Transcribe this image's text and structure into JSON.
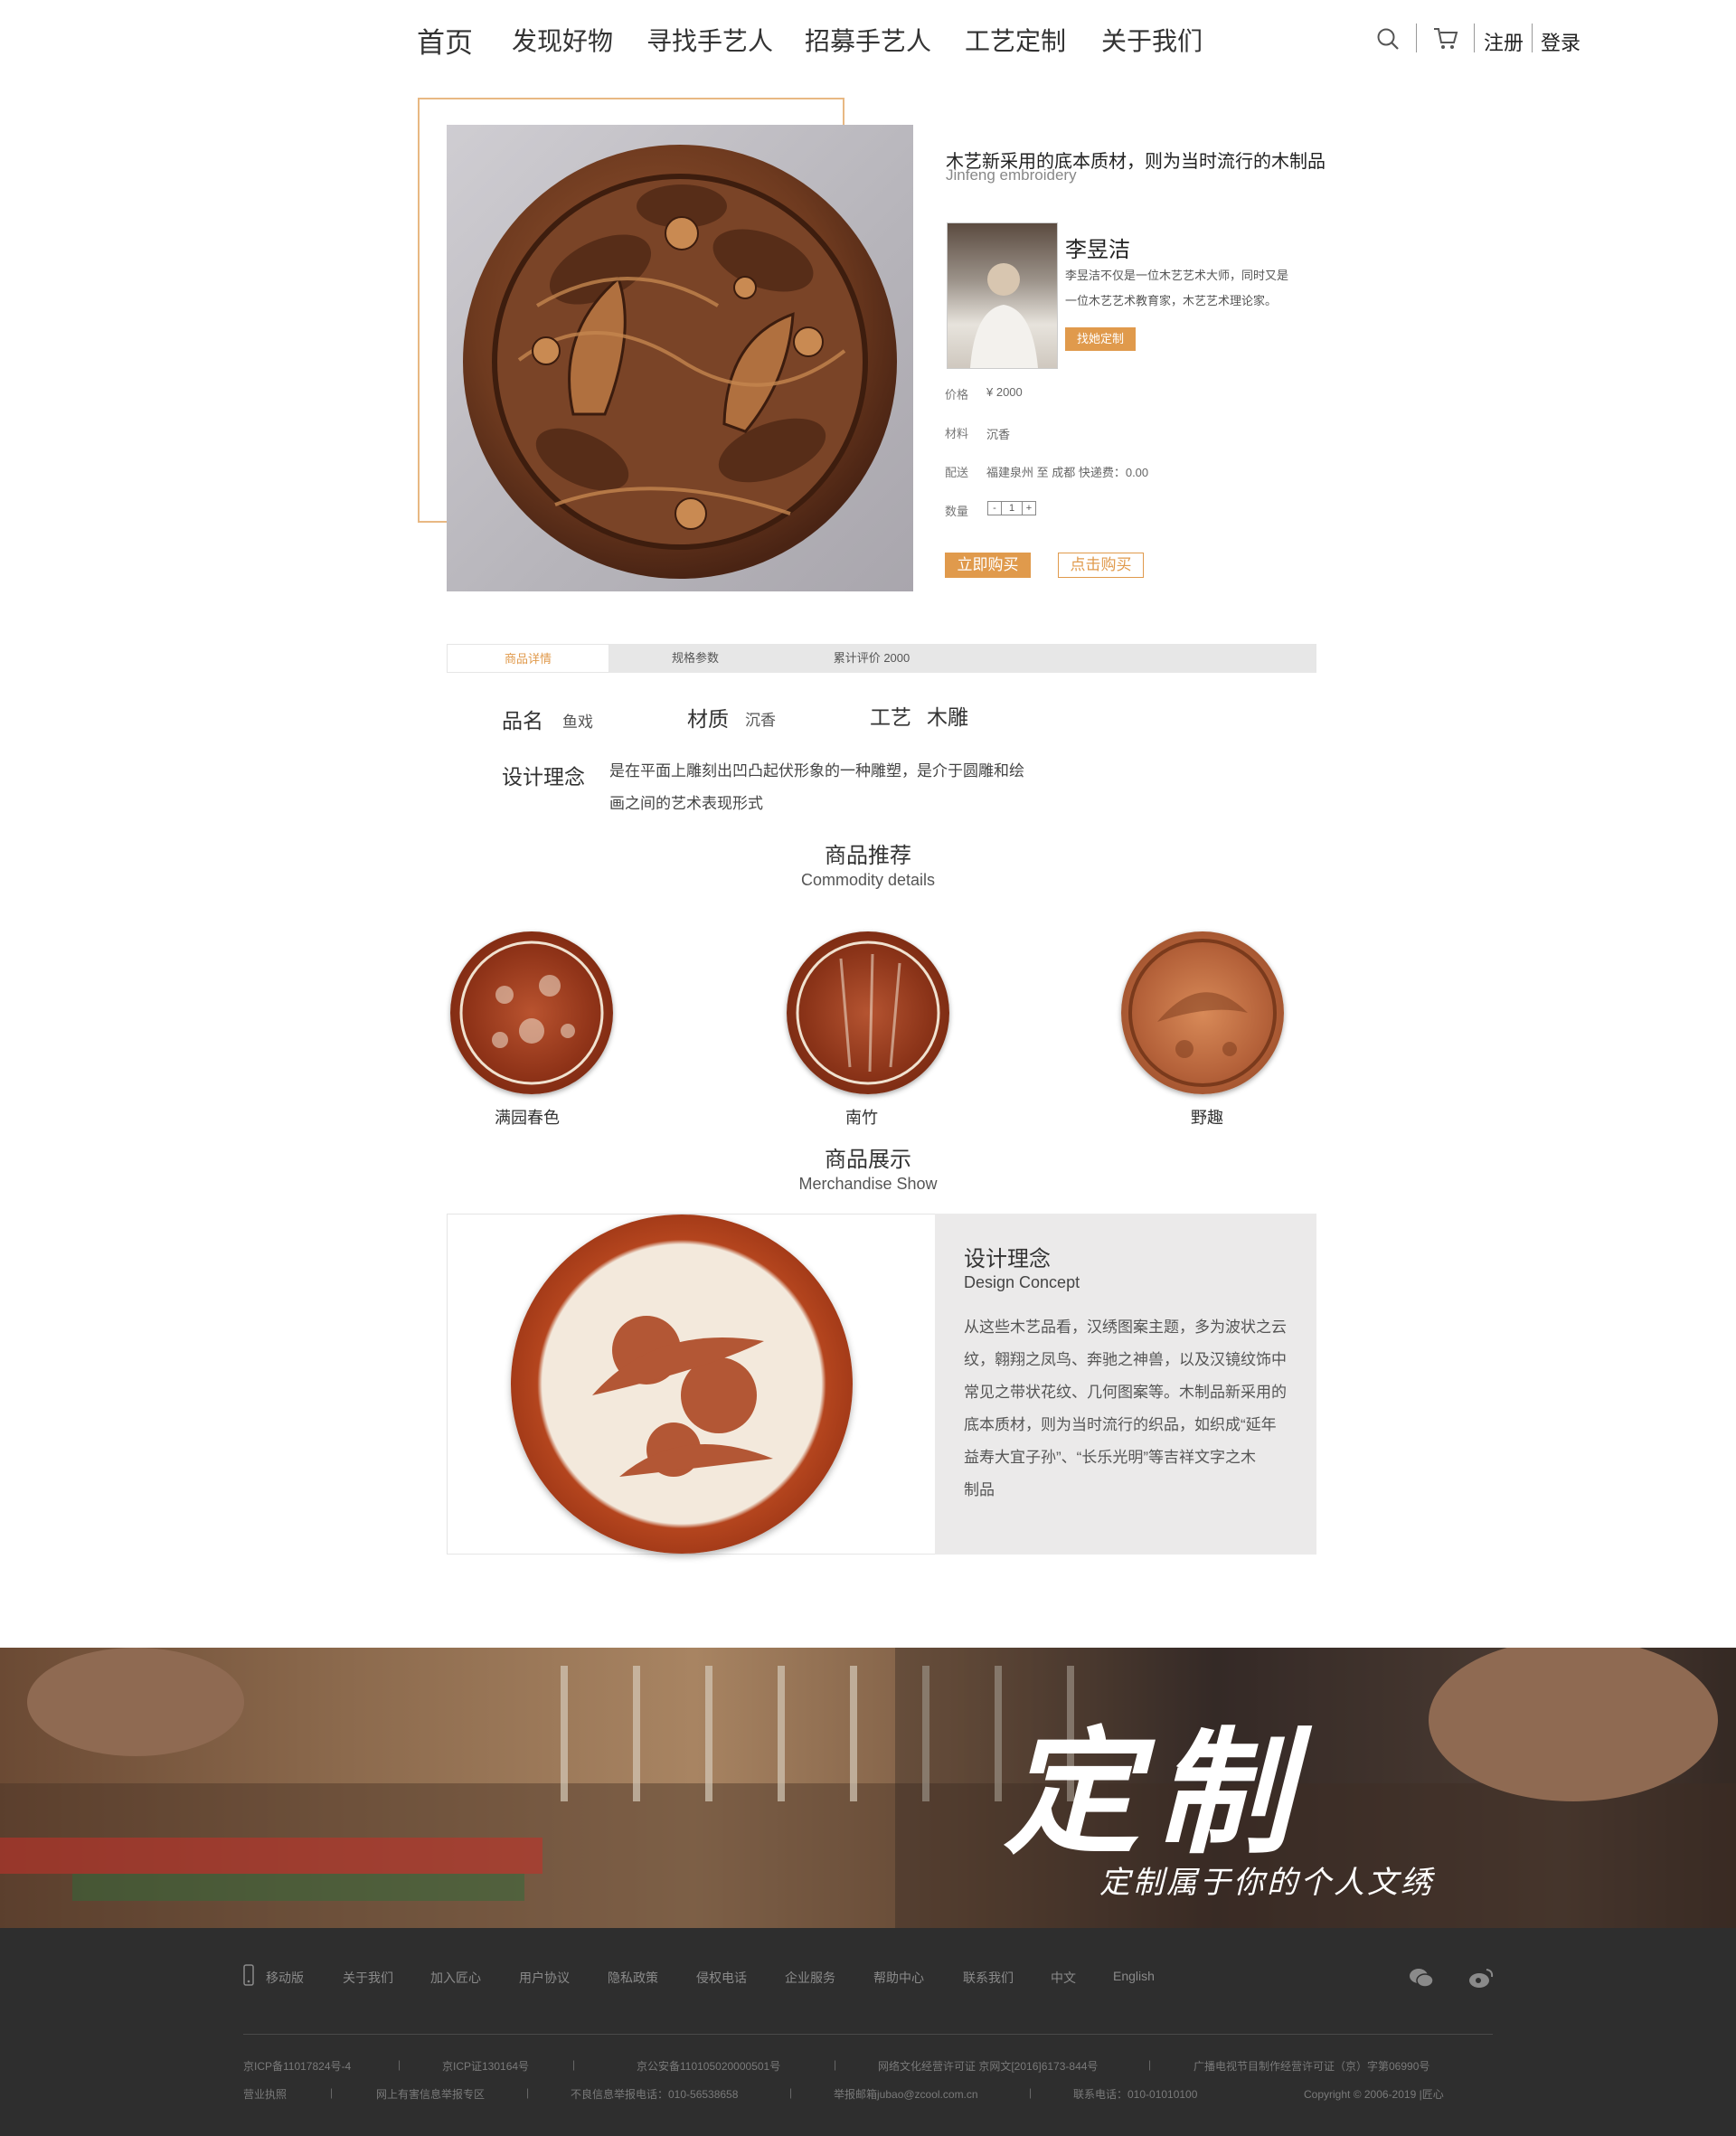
{
  "nav": {
    "items": [
      "首页",
      "发现好物",
      "寻找手艺人",
      "招募手艺人",
      "工艺定制",
      "关于我们"
    ],
    "register": "注册",
    "login": "登录"
  },
  "product": {
    "title": "木艺新采用的底本质材，则为当时流行的木制品",
    "subtitle": "Jinfeng embroidery",
    "artisan": {
      "name": "李昱洁",
      "bio_line1": "李昱洁不仅是一位木艺艺术大师，同时又是",
      "bio_line2": "一位木艺艺术教育家，木艺艺术理论家。",
      "contact_button": "找她定制"
    },
    "price_label": "价格",
    "price_value": "¥ 2000",
    "material_label": "材料",
    "material_value": "沉香",
    "shipping_label": "配送",
    "shipping_value": "福建泉州 至 成都  快递费：0.00",
    "quantity_label": "数量",
    "quantity_value": "1",
    "buy_now": "立即购买",
    "click_buy": "点击购买"
  },
  "tabs": [
    "商品详情",
    "规格参数",
    "累计评价 2000"
  ],
  "specs": {
    "name_key": "品名",
    "name_val": "鱼戏",
    "material_key": "材质",
    "material_val": "沉香",
    "craft_key": "工艺",
    "craft_val": "木雕",
    "concept_key": "设计理念",
    "concept_line1": "是在平面上雕刻出凹凸起伏形象的一种雕塑，是介于圆雕和绘",
    "concept_line2": "画之间的艺术表现形式"
  },
  "recommend": {
    "title": "商品推荐",
    "subtitle": "Commodity details",
    "items": [
      "满园春色",
      "南竹",
      "野趣"
    ]
  },
  "showcase": {
    "title": "商品展示",
    "subtitle": "Merchandise Show",
    "concept_title": "设计理念",
    "concept_subtitle": "Design Concept",
    "lines": [
      "从这些木艺品看，汉绣图案主题，多为波状之云",
      "纹，翱翔之凤鸟、奔驰之神兽，以及汉镜纹饰中",
      "常见之带状花纹、几何图案等。木制品新采用的",
      "底本质材，则为当时流行的织品，如织成“延年",
      "益寿大宜子孙”、“长乐光明”等吉祥文字之木",
      "制品"
    ]
  },
  "banner": {
    "title": "定制",
    "slogan": "定制属于你的个人文绣"
  },
  "footer": {
    "links": [
      "移动版",
      "关于我们",
      "加入匠心",
      "用户协议",
      "隐私政策",
      "侵权电话",
      "企业服务",
      "帮助中心",
      "联系我们",
      "中文",
      "English"
    ],
    "row1": [
      "京ICP备11017824号-4",
      "京ICP证130164号",
      "京公安备110105020000501号",
      "网络文化经营许可证 京网文[2016]6173-844号",
      "广播电视节目制作经营许可证（京）字第06990号"
    ],
    "row2": [
      "营业执照",
      "网上有害信息举报专区",
      "不良信息举报电话：010-56538658",
      "举报邮箱jubao@zcool.com.cn",
      "联系电话：010-01010100"
    ],
    "copyright": "Copyright © 2006-2019 |匠心"
  },
  "colors": {
    "accent": "#e09a4c",
    "frame": "#e8b883",
    "footer_bg": "#2e2e2e",
    "tab_bg": "#e7e7e7",
    "panel_bg": "#ebeaea"
  }
}
